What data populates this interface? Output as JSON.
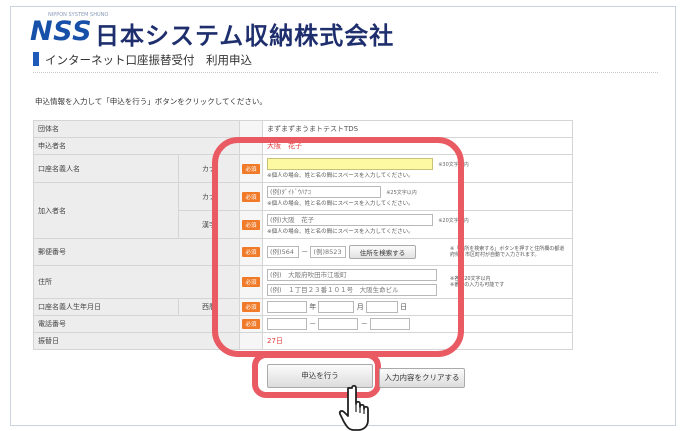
{
  "header": {
    "brand": "NSS",
    "brand_small": "NIPPON SYSTEM SHUNO",
    "company": "日本システム収納株式会社"
  },
  "page": {
    "title": "インターネット口座振替受付　利用申込",
    "instruction": "申込情報を入力して「申込を行う」ボタンをクリックしてください。"
  },
  "badge_required": "必須",
  "form": {
    "group_label": "団体名",
    "group_value": "まずまずまうまトテストTDS",
    "applicant_label": "申込者名",
    "applicant_value": "大阪　花子",
    "account_holder_label": "口座名義人名",
    "account_holder_sub": "カナ",
    "account_holder_hint": "※30文字以内",
    "account_holder_note": "※個人の場合、姓と名の間にスペースを入力してください。",
    "member_label": "加入者名",
    "member_kana_sub": "カナ",
    "member_kana_placeholder": "(例)ﾀﾞｲﾄﾞｳﾊﾅｺ",
    "member_kana_hint": "※25文字以内",
    "member_kana_note": "※個人の場合、姓と名の間にスペースを入力してください。",
    "member_kanji_sub": "漢字",
    "member_kanji_placeholder": "(例)大阪　花子",
    "member_kanji_hint": "※20文字以内",
    "member_kanji_note": "※個人の場合、姓と名の間にスペースを入力してください。",
    "postal_label": "郵便番号",
    "postal1_placeholder": "(例)564",
    "postal_sep": "－",
    "postal2_placeholder": "(例)8523",
    "address_search_button": "住所を検索する",
    "postal_note": "※「住所を検索する」ボタンを押すと住所欄の都道府県・市区町村が自動で入力されます。",
    "address_label": "住所",
    "address1_placeholder": "(例)　大阪府吹田市江坂町",
    "address2_placeholder": "(例)　１丁目２３番１０１号　大阪生命ビル",
    "address1_hint": "※各行20文字以内",
    "address2_hint": "※番地の入力も可能です",
    "birth_label": "口座名義人生年月日",
    "birth_sub": "西暦",
    "year_unit": "年",
    "month_unit": "月",
    "day_unit": "日",
    "phone_label": "電話番号",
    "phone_sep": "－",
    "transfer_label": "振替日",
    "transfer_value": "27日"
  },
  "buttons": {
    "submit": "申込を行う",
    "clear": "入力内容をクリアする"
  }
}
